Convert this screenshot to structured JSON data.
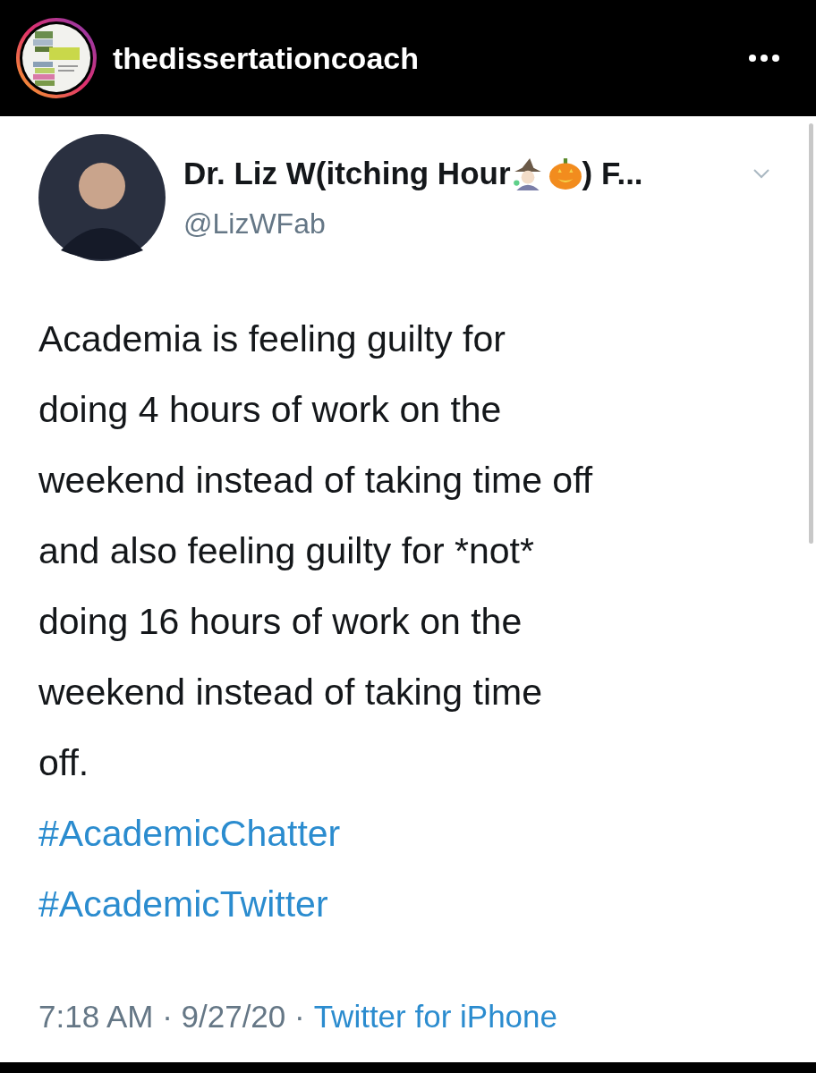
{
  "post_header": {
    "username": "thedissertationcoach"
  },
  "tweet": {
    "display_name_start": "Dr. Liz W(itching Hour",
    "display_name_end": ") F...",
    "handle": "@LizWFab",
    "text": "Academia is feeling guilty for\ndoing 4 hours of work on the\nweekend instead of taking time off\nand also feeling guilty for *not*\ndoing 16 hours of work on the\nweekend instead of taking time\noff.",
    "hashtags": [
      "#AcademicChatter",
      "#AcademicTwitter"
    ],
    "timestamp": "7:18 AM · 9/27/20 ·",
    "source": "Twitter for iPhone"
  }
}
